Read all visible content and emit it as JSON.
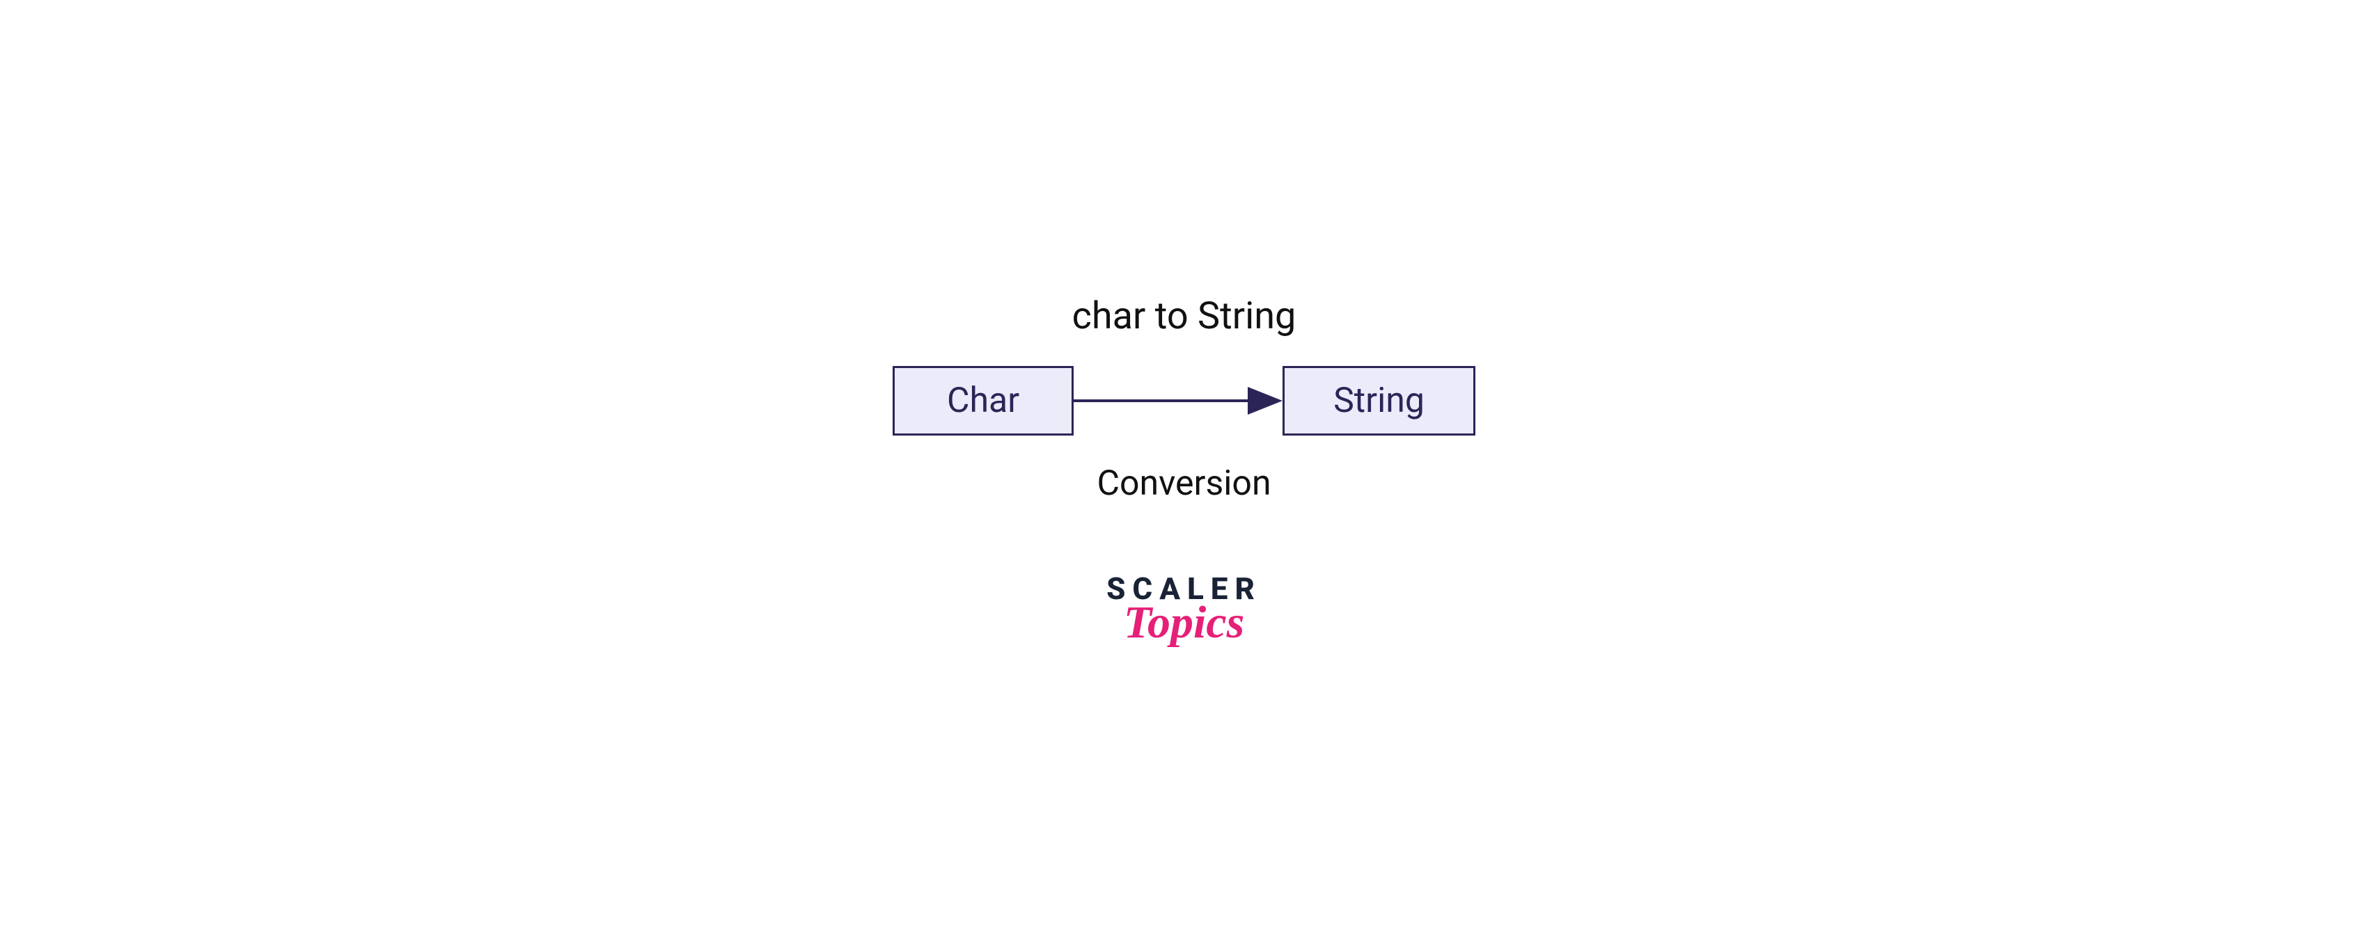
{
  "diagram": {
    "title": "char to String",
    "source_node": "Char",
    "target_node": "String",
    "caption": "Conversion"
  },
  "brand": {
    "line1": "SCALER",
    "line2": "Topics"
  },
  "colors": {
    "node_fill": "#ecebfa",
    "node_border": "#2b2557",
    "node_text": "#2b2557",
    "title_text": "#111111",
    "brand_dark": "#1a2236",
    "brand_pink": "#e61f78"
  }
}
